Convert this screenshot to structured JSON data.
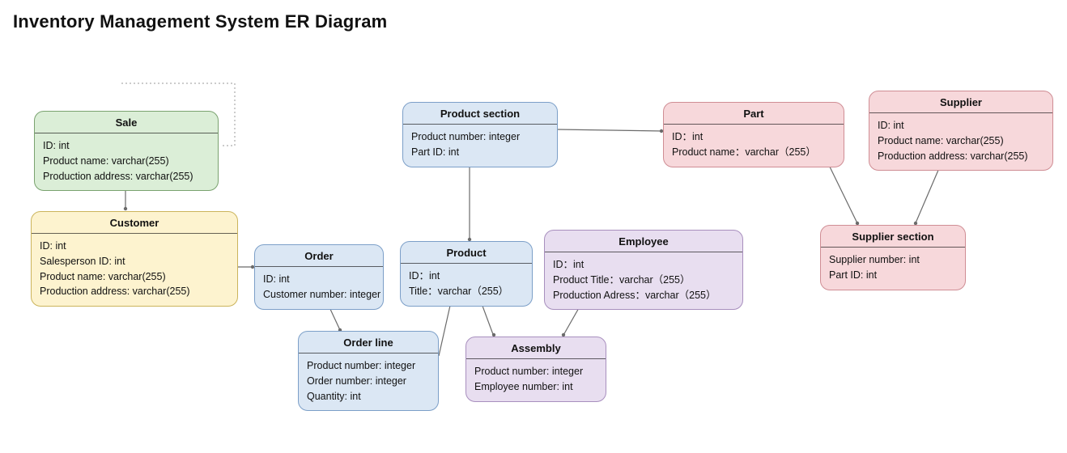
{
  "title": "Inventory Management System ER Diagram",
  "entities": {
    "sale": {
      "name": "Sale",
      "attrs": [
        "ID: int",
        "Product name: varchar(255)",
        "Production address: varchar(255)"
      ]
    },
    "customer": {
      "name": "Customer",
      "attrs": [
        "ID: int",
        "Salesperson ID: int",
        "Product name: varchar(255)",
        "Production address: varchar(255)"
      ]
    },
    "order": {
      "name": "Order",
      "attrs": [
        "ID: int",
        "Customer number: integer"
      ]
    },
    "orderline": {
      "name": "Order line",
      "attrs": [
        "Product number: integer",
        "Order number: integer",
        "Quantity: int"
      ]
    },
    "productsection": {
      "name": "Product section",
      "attrs": [
        "Product number: integer",
        "Part ID: int"
      ]
    },
    "product": {
      "name": "Product",
      "attrs": [
        "ID：int",
        "Title：varchar（255）"
      ]
    },
    "assembly": {
      "name": "Assembly",
      "attrs": [
        "Product number: integer",
        "Employee number: int"
      ]
    },
    "employee": {
      "name": "Employee",
      "attrs": [
        "ID：int",
        "Product Title：varchar（255）",
        "Production Adress：varchar（255）"
      ]
    },
    "part": {
      "name": "Part",
      "attrs": [
        "ID：int",
        "Product name：varchar（255）"
      ]
    },
    "supplier": {
      "name": "Supplier",
      "attrs": [
        "ID: int",
        "Product name: varchar(255)",
        "Production address: varchar(255)"
      ]
    },
    "suppliersection": {
      "name": "Supplier section",
      "attrs": [
        "Supplier number: int",
        "Part ID: int"
      ]
    }
  },
  "colors": {
    "green": "#dbeed7",
    "yellow": "#fdf3cf",
    "blue": "#dbe7f4",
    "purple": "#e8def0",
    "pink": "#f7d8db",
    "line": "#6b6b6b",
    "dotted": "#9a9a9a"
  }
}
